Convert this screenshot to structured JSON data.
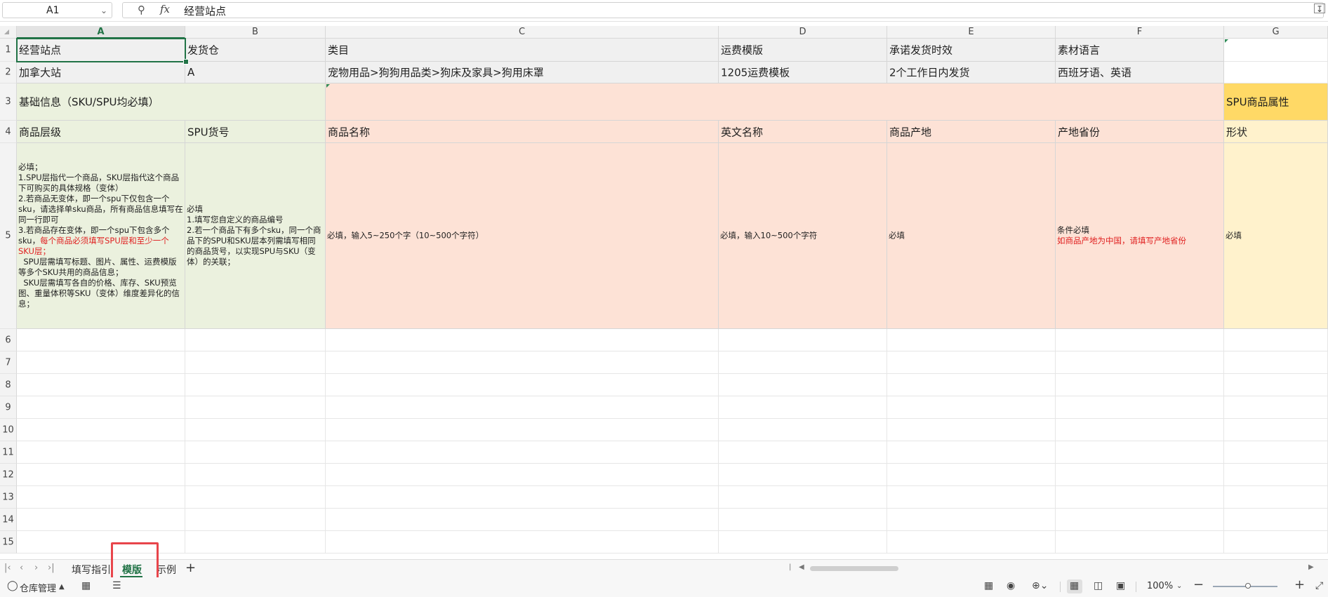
{
  "formula_bar": {
    "cell_ref": "A1",
    "formula_value": "经营站点",
    "fx_label": "fx"
  },
  "columns": [
    "A",
    "B",
    "C",
    "D",
    "E",
    "F",
    "G"
  ],
  "rows": [
    "1",
    "2",
    "3",
    "4",
    "5",
    "6",
    "7",
    "8",
    "9",
    "10",
    "11",
    "12",
    "13",
    "14",
    "15"
  ],
  "cells": {
    "row1": {
      "a": "经营站点",
      "b": "发货仓",
      "c": "类目",
      "d": "运费模版",
      "e": "承诺发货时效",
      "f": "素材语言"
    },
    "row2": {
      "a": "加拿大站",
      "b": "A",
      "c": "宠物用品>狗狗用品类>狗床及家具>狗用床罩",
      "d": "1205运费模板",
      "e": "2个工作日内发货",
      "f": "西班牙语、英语"
    },
    "row3": {
      "a": "基础信息（SKU/SPU均必填）",
      "g": "SPU商品属性"
    },
    "row4": {
      "a": "商品层级",
      "b": "SPU货号",
      "c": "商品名称",
      "d": "英文名称",
      "e": "商品产地",
      "f": "产地省份",
      "g": "形状"
    },
    "row5": {
      "a_lines": [
        "必填；",
        "1.SPU层指代一个商品，SKU层指代这个商品下可购买的具体规格（变体）",
        "2.若商品无变体，即一个spu下仅包含一个sku，请选择单sku商品，所有商品信息填写在同一行即可",
        "3.若商品存在变体，即一个spu下包含多个sku，"
      ],
      "a_red": "每个商品必须填写SPU层和至少一个SKU层；",
      "a_tail_1": "SPU层需填写标题、图片、属性、运费模版等多个SKU共用的商品信息；",
      "a_tail_2": "SKU层需填写各自的价格、库存、SKU预览图、重量体积等SKU（变体）维度差异化的信息；",
      "b_lines": [
        "必填",
        "1.填写您自定义的商品编号",
        "2.若一个商品下有多个sku，同一个商品下的SPU和SKU层本列需填写相同的商品货号，以实现SPU与SKU（变体）的关联；"
      ],
      "c": "必填，输入5~250个字（10~500个字符）",
      "d": "必填，输入10~500个字符",
      "e": "必填",
      "f_line1": "条件必填",
      "f_red": "如商品产地为中国，请填写产地省份",
      "g": "必填"
    }
  },
  "sheet_tabs": {
    "tab1": "填写指引",
    "tab2": "模版",
    "tab3": "示例"
  },
  "status_bar": {
    "warehouse": "仓库管理",
    "zoom": "100%"
  },
  "colors": {
    "green_fill": "#ebf1de",
    "salmon_fill": "#fde2d6",
    "yellow_fill": "#ffd966",
    "light_yellow_fill": "#fff2cc",
    "accent": "#217346",
    "highlight_box": "#e8454b"
  }
}
